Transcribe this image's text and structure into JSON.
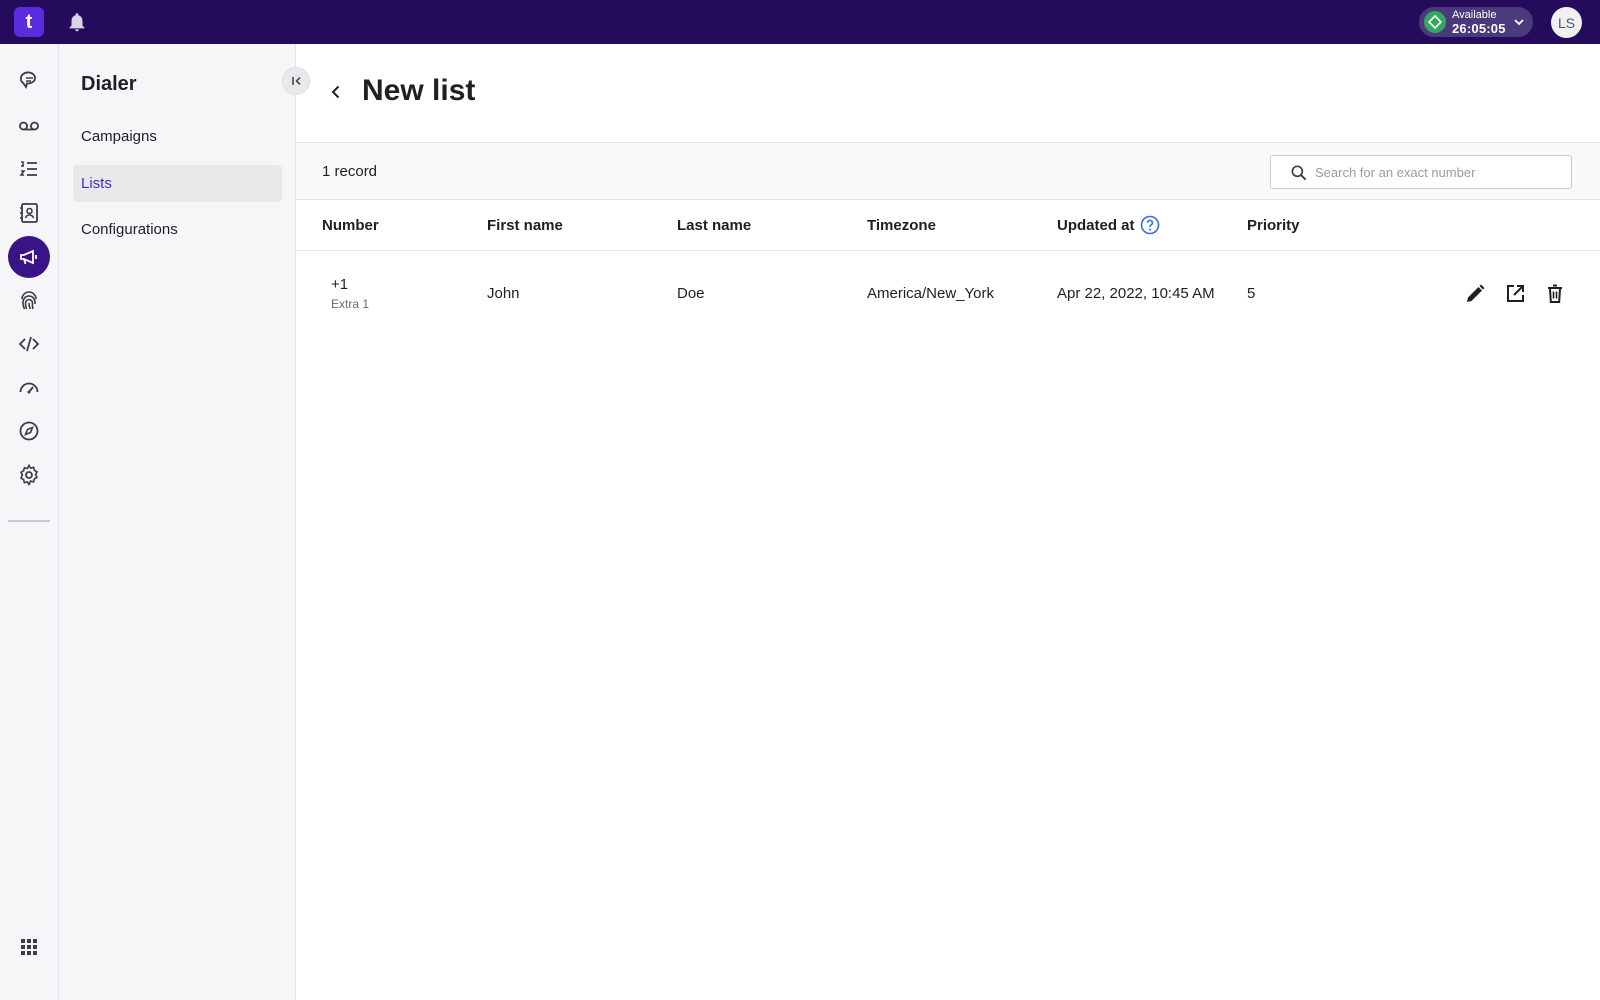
{
  "topbar": {
    "logo_text": "t",
    "status": {
      "label": "Available",
      "timer": "26:05:05",
      "color": "#33a85e"
    },
    "avatar_initials": "LS",
    "brand_color": "#240b5c"
  },
  "rail": {
    "active_color": "#3a1386",
    "items": [
      {
        "icon": "conversations-icon"
      },
      {
        "icon": "voicemail-icon"
      },
      {
        "icon": "list-icon"
      },
      {
        "icon": "contacts-icon"
      },
      {
        "icon": "dialer-megaphone-icon",
        "active": true
      },
      {
        "icon": "fingerprint-icon"
      },
      {
        "icon": "code-icon"
      },
      {
        "icon": "dashboard-gauge-icon"
      },
      {
        "icon": "compass-icon"
      },
      {
        "icon": "settings-gear-icon"
      },
      {
        "icon": "apps-grid-icon"
      }
    ]
  },
  "subnav": {
    "title": "Dialer",
    "items": [
      {
        "label": "Campaigns"
      },
      {
        "label": "Lists",
        "selected": true
      },
      {
        "label": "Configurations"
      }
    ]
  },
  "main": {
    "title": "New list",
    "record_count": "1 record",
    "search": {
      "placeholder": "Search for an exact number",
      "value": ""
    },
    "columns": [
      "Number",
      "First name",
      "Last name",
      "Timezone",
      "Updated at",
      "Priority"
    ],
    "rows": [
      {
        "number": "+1",
        "number_extra": "Extra 1",
        "first_name": "John",
        "last_name": "Doe",
        "timezone": "America/New_York",
        "updated_at": "Apr 22, 2022, 10:45 AM",
        "priority": "5"
      }
    ],
    "row_actions": [
      "edit-icon",
      "open-external-icon",
      "delete-icon"
    ]
  }
}
